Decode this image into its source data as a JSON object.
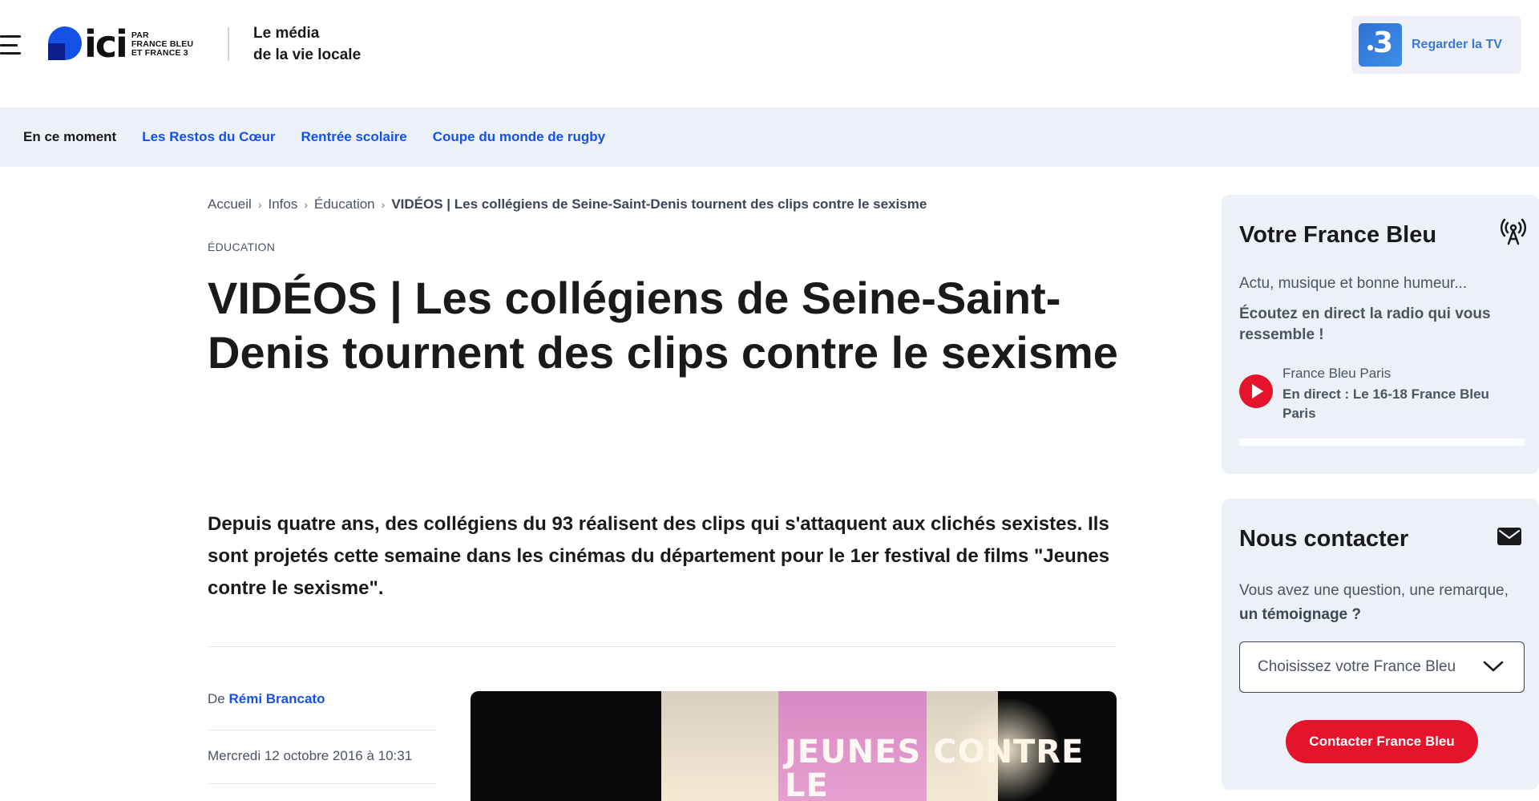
{
  "header": {
    "logo_word": "ici",
    "logo_sub": [
      "PAR",
      "FRANCE BLEU",
      "ET FRANCE 3"
    ],
    "tagline_line1": "Le média",
    "tagline_line2": "de la vie locale",
    "tv_button_number": "3",
    "tv_button_label": "Regarder la TV"
  },
  "trending": {
    "label": "En ce moment",
    "links": [
      "Les Restos du Cœur",
      "Rentrée scolaire",
      "Coupe du monde de rugby"
    ]
  },
  "breadcrumb": {
    "items": [
      "Accueil",
      "Infos",
      "Éducation"
    ],
    "current": "VIDÉOS | Les collégiens de Seine-Saint-Denis tournent des clips contre le sexisme"
  },
  "article": {
    "kicker": "ÉDUCATION",
    "title": "VIDÉOS | Les collégiens de Seine-Saint-Denis tournent des clips contre le sexisme",
    "chapo": "Depuis quatre ans, des collégiens du 93 réalisent des clips qui s'attaquent aux clichés sexistes. Ils sont projetés cette semaine dans les cinémas du département pour le 1er festival de films \"Jeunes contre le sexisme\".",
    "author_prefix": "De",
    "author_name": "Rémi Brancato",
    "date": "Mercredi 12 octobre 2016 à 10:31",
    "video_poster_text": "JEUNES CONTRE LE"
  },
  "sidebar": {
    "radio": {
      "title": "Votre France Bleu",
      "lead": "Actu, musique et bonne humeur...",
      "cta": "Écoutez en direct la radio qui vous ressemble !",
      "station": "France Bleu Paris",
      "live": "En direct : Le 16-18 France Bleu Paris"
    },
    "contact": {
      "title": "Nous contacter",
      "question_plain": "Vous avez une question, une remarque,",
      "question_bold": "un témoignage ?",
      "select_value": "Choisissez votre France Bleu",
      "button": "Contacter France Bleu"
    }
  },
  "colors": {
    "brand_blue": "#1451e6",
    "brand_red": "#e5132b",
    "panel_bg": "#ecf1f8"
  }
}
